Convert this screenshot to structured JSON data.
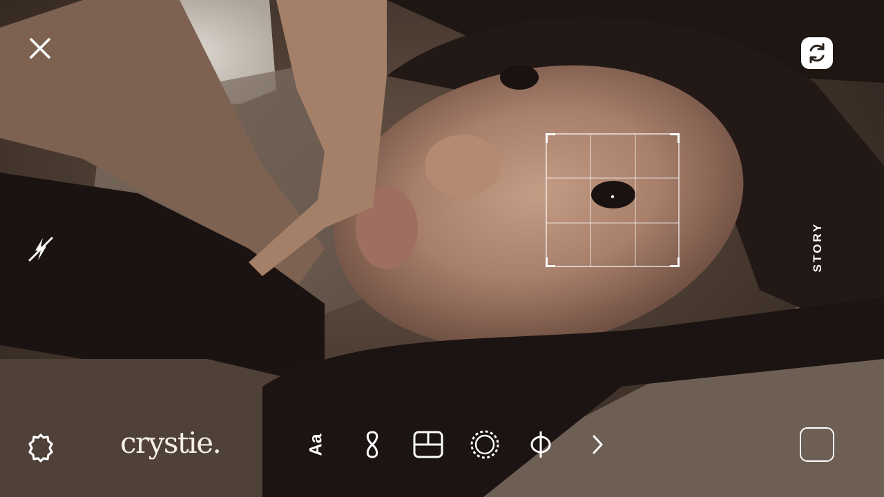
{
  "camera": {
    "close_icon": "close-icon",
    "flip_icon": "flip-camera-icon",
    "flash_icon": "flash-off-icon",
    "settings_icon": "settings-icon",
    "mode_label": "STORY",
    "brand_text": "crystie.",
    "gallery_icon": "gallery-thumbnail-icon"
  },
  "tools": [
    {
      "name": "text-tool",
      "label": "Aa"
    },
    {
      "name": "boomerang-tool",
      "icon": "infinity-icon"
    },
    {
      "name": "layout-tool",
      "icon": "layout-icon"
    },
    {
      "name": "effects-tool",
      "icon": "dashed-circle-icon"
    },
    {
      "name": "filter-tool",
      "icon": "phi-icon"
    },
    {
      "name": "more-tools",
      "icon": "chevron-right-icon"
    }
  ],
  "colors": {
    "overlay_icon": "#ffffff",
    "brand_text": "#f4efe8"
  }
}
